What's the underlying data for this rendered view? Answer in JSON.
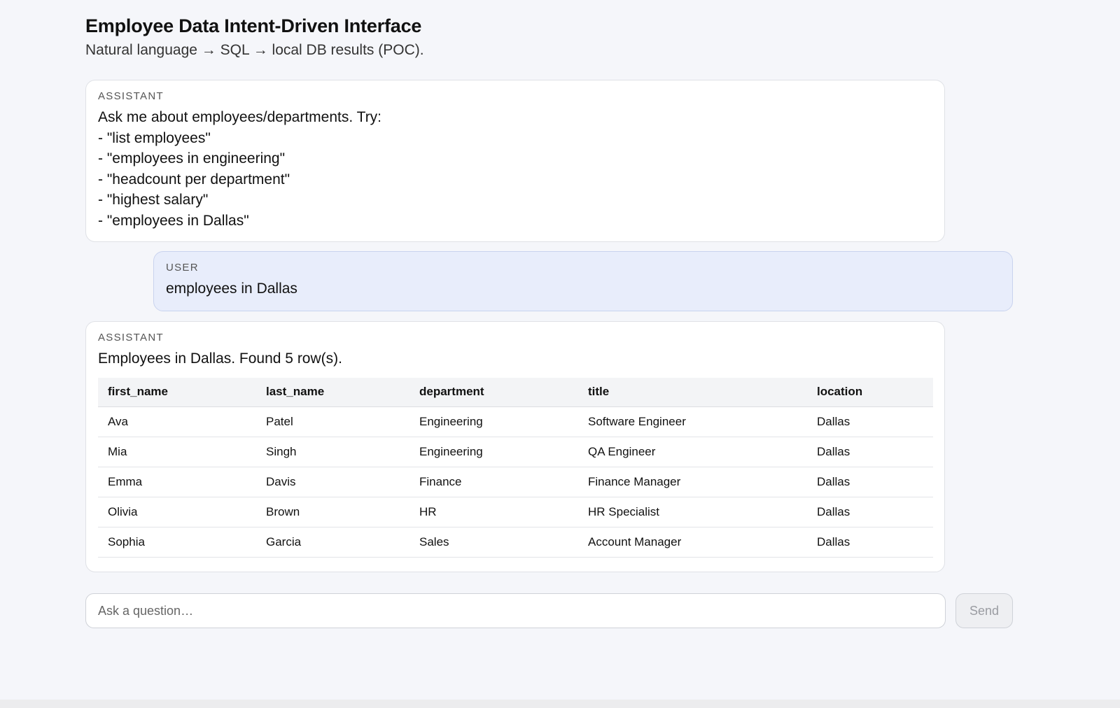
{
  "header": {
    "title": "Employee Data Intent-Driven Interface",
    "subtitle": "Natural language → SQL → local DB results (POC)."
  },
  "messages": [
    {
      "role": "ASSISTANT",
      "lines": [
        "Ask me about employees/departments. Try:",
        "- \"list employees\"",
        "- \"employees in engineering\"",
        "- \"headcount per department\"",
        "- \"highest salary\"",
        "- \"employees in Dallas\""
      ]
    },
    {
      "role": "USER",
      "text": "employees in Dallas"
    },
    {
      "role": "ASSISTANT",
      "text": "Employees in Dallas. Found 5 row(s).",
      "table": {
        "columns": [
          "first_name",
          "last_name",
          "department",
          "title",
          "location"
        ],
        "rows": [
          [
            "Ava",
            "Patel",
            "Engineering",
            "Software Engineer",
            "Dallas"
          ],
          [
            "Mia",
            "Singh",
            "Engineering",
            "QA Engineer",
            "Dallas"
          ],
          [
            "Emma",
            "Davis",
            "Finance",
            "Finance Manager",
            "Dallas"
          ],
          [
            "Olivia",
            "Brown",
            "HR",
            "HR Specialist",
            "Dallas"
          ],
          [
            "Sophia",
            "Garcia",
            "Sales",
            "Account Manager",
            "Dallas"
          ]
        ]
      }
    }
  ],
  "composer": {
    "placeholder": "Ask a question…",
    "send_label": "Send"
  }
}
